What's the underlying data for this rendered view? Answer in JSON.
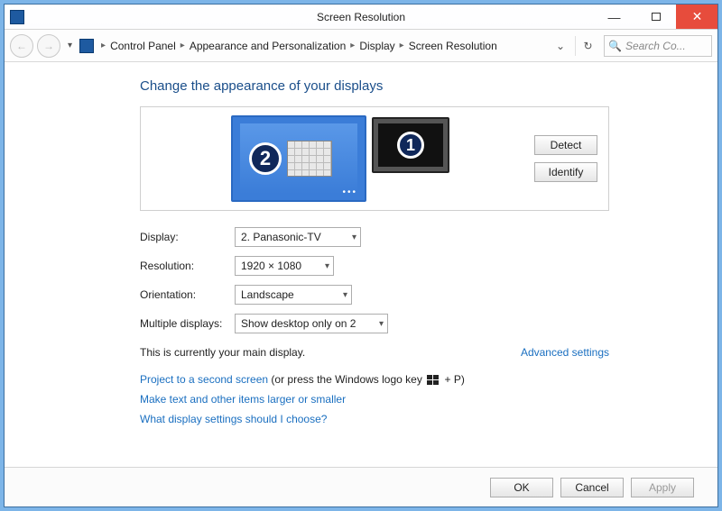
{
  "window": {
    "title": "Screen Resolution"
  },
  "breadcrumb": {
    "items": [
      "Control Panel",
      "Appearance and Personalization",
      "Display",
      "Screen Resolution"
    ]
  },
  "search": {
    "placeholder": "Search Co..."
  },
  "page": {
    "heading": "Change the appearance of your displays"
  },
  "monitors": {
    "primary_number": "2",
    "secondary_number": "1",
    "detect_label": "Detect",
    "identify_label": "Identify"
  },
  "form": {
    "display_label": "Display:",
    "display_value": "2. Panasonic-TV",
    "resolution_label": "Resolution:",
    "resolution_value": "1920 × 1080",
    "orientation_label": "Orientation:",
    "orientation_value": "Landscape",
    "multiple_label": "Multiple displays:",
    "multiple_value": "Show desktop only on 2"
  },
  "notes": {
    "main_display": "This is currently your main display.",
    "advanced": "Advanced settings",
    "project_link": "Project to a second screen",
    "project_suffix_a": " (or press the Windows logo key ",
    "project_suffix_b": " + P)",
    "scale_link": "Make text and other items larger or smaller",
    "help_link": "What display settings should I choose?"
  },
  "buttons": {
    "ok": "OK",
    "cancel": "Cancel",
    "apply": "Apply"
  }
}
